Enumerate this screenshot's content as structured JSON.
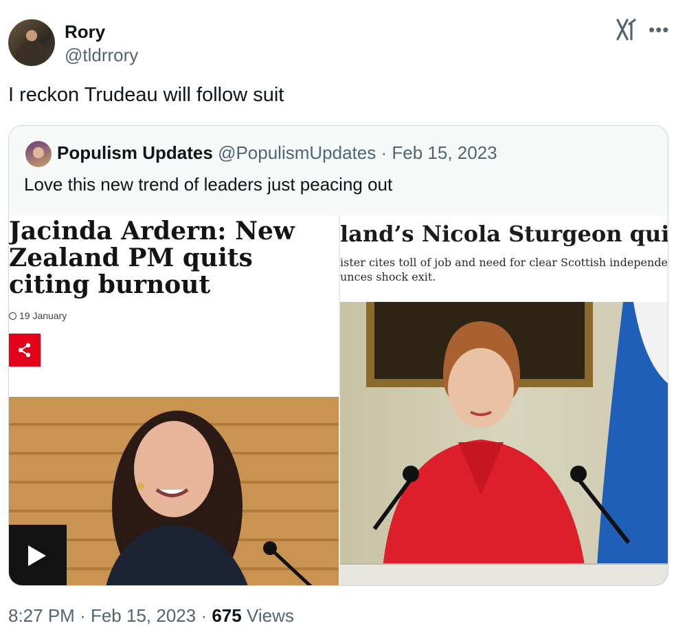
{
  "author": {
    "name": "Rory",
    "handle": "@tldrrory"
  },
  "tweet": {
    "text": "I reckon Trudeau will follow suit"
  },
  "quote": {
    "name": "Populism Updates",
    "handle": "@PopulismUpdates",
    "separator": "·",
    "date": "Feb 15, 2023",
    "text": "Love this new trend of leaders just peacing out"
  },
  "media_left": {
    "headline": "Jacinda Ardern: New Zealand PM quits citing burnout",
    "date": "19 January"
  },
  "media_right": {
    "headline": "land’s Nicola Sturgeon quits",
    "subline_1": "ister cites toll of job and need for clear Scottish independence stra",
    "subline_2": "unces shock exit."
  },
  "footer": {
    "time": "8:27 PM",
    "separator": "·",
    "date": "Feb 15, 2023",
    "views_count": "675",
    "views_label": "Views"
  },
  "icons": [
    "x-logo-icon",
    "more-icon",
    "clock-icon",
    "share-icon",
    "play-icon"
  ],
  "colors": {
    "secondary_text": "#536471",
    "bbc_red": "#e3001b",
    "border": "#cfd9de"
  }
}
